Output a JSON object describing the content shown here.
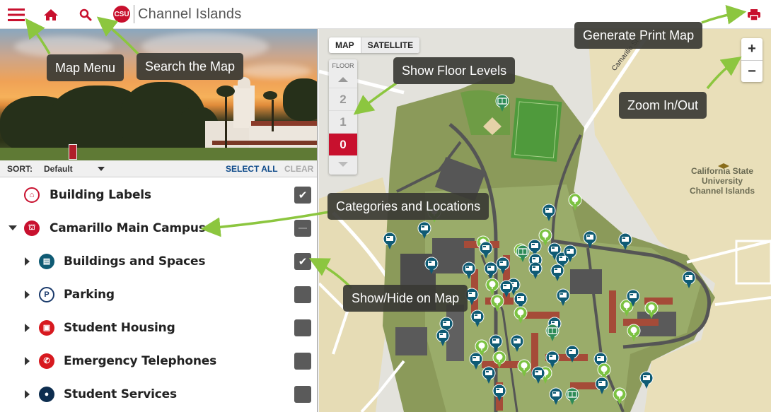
{
  "header": {
    "logo_mark": "CSU",
    "logo_text": "Channel Islands",
    "icons": {
      "menu": "hamburger-menu-icon",
      "home": "home-icon",
      "search": "search-icon",
      "print": "printer-icon"
    }
  },
  "sidebar": {
    "sort": {
      "label": "SORT:",
      "value": "Default",
      "select_all": "SELECT ALL",
      "clear": "CLEAR"
    },
    "categories": [
      {
        "label": "Building Labels",
        "icon": "building-labels-icon",
        "color": "#c8102e",
        "glyph": "⌂",
        "level": 0,
        "expand": "none",
        "checked": "checked"
      },
      {
        "label": "Camarillo Main Campus",
        "icon": "campus-icon",
        "color": "#c8102e",
        "glyph": "⛫",
        "level": 0,
        "expand": "expanded",
        "checked": "partial"
      },
      {
        "label": "Buildings and Spaces",
        "icon": "building-icon",
        "color": "#0f5b74",
        "glyph": "▤",
        "level": 1,
        "expand": "collapsed",
        "checked": "checked"
      },
      {
        "label": "Parking",
        "icon": "parking-icon",
        "color": "#1a3a6b",
        "glyph": "P",
        "level": 1,
        "expand": "collapsed",
        "checked": "unchecked"
      },
      {
        "label": "Student Housing",
        "icon": "housing-icon",
        "color": "#d7191f",
        "glyph": "▣",
        "level": 1,
        "expand": "collapsed",
        "checked": "unchecked"
      },
      {
        "label": "Emergency Telephones",
        "icon": "telephone-icon",
        "color": "#d7191f",
        "glyph": "✆",
        "level": 1,
        "expand": "collapsed",
        "checked": "unchecked"
      },
      {
        "label": "Student Services",
        "icon": "user-icon",
        "color": "#0d2d4f",
        "glyph": "●",
        "level": 1,
        "expand": "collapsed",
        "checked": "unchecked"
      }
    ]
  },
  "map": {
    "map_types": {
      "active": "MAP",
      "inactive": "SATELLITE"
    },
    "floor": {
      "label": "FLOOR",
      "levels": [
        "2",
        "1",
        "0"
      ],
      "active_level": "0"
    },
    "zoom": {
      "in": "+",
      "out": "−"
    },
    "campus_label": [
      "California State",
      "University",
      "Channel Islands"
    ],
    "street_label": "Camarillo St",
    "colors": {
      "building_pin": "#0f5b74",
      "tree_pin": "#7cc242",
      "sports_pin": "#2e8b57",
      "accent": "#c8102e"
    }
  },
  "annotations": [
    {
      "id": "map-menu",
      "text": "Map Menu"
    },
    {
      "id": "search-map",
      "text": "Search the Map"
    },
    {
      "id": "floor-levels",
      "text": "Show Floor Levels"
    },
    {
      "id": "print-map",
      "text": "Generate Print Map"
    },
    {
      "id": "zoom-inout",
      "text": "Zoom In/Out"
    },
    {
      "id": "categories",
      "text": "Categories and Locations"
    },
    {
      "id": "show-hide",
      "text": "Show/Hide on Map"
    }
  ]
}
